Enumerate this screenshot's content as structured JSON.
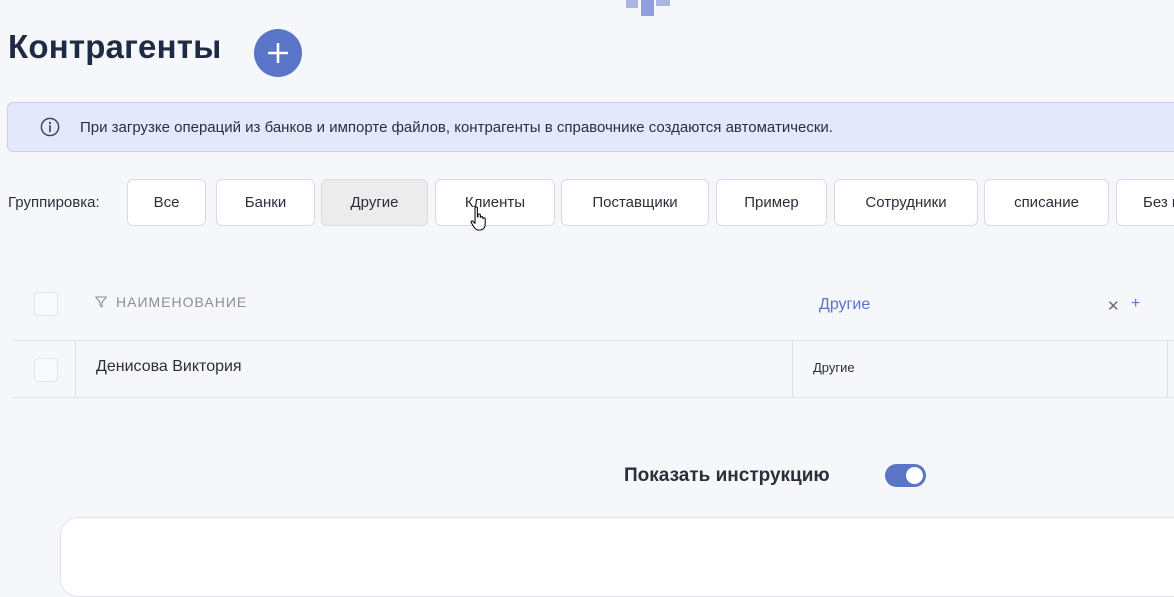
{
  "page": {
    "title": "Контрагенты",
    "add_icon": "plus-icon"
  },
  "info_banner": {
    "icon": "info-icon",
    "text": "При загрузке операций из банков и импорте файлов, контрагенты в справочнике создаются автоматически."
  },
  "grouping": {
    "label": "Группировка:",
    "active": "Другие",
    "chips": [
      {
        "label": "Все"
      },
      {
        "label": "Банки"
      },
      {
        "label": "Другие"
      },
      {
        "label": "Клиенты"
      },
      {
        "label": "Поставщики"
      },
      {
        "label": "Пример"
      },
      {
        "label": "Сотрудники"
      },
      {
        "label": "списание"
      },
      {
        "label": "Без г"
      }
    ]
  },
  "table": {
    "columns": {
      "name": "НАИМЕНОВАНИЕ",
      "group": "Другие",
      "remove_symbol": "✕",
      "add_symbol": "+"
    },
    "rows": [
      {
        "name": "Денисова Виктория",
        "group": "Другие"
      }
    ]
  },
  "instructions": {
    "label": "Показать инструкцию",
    "enabled": true
  },
  "colors": {
    "accent": "#5a74c8",
    "banner_bg": "#e3e8fb",
    "page_bg": "#f6f7fb"
  }
}
